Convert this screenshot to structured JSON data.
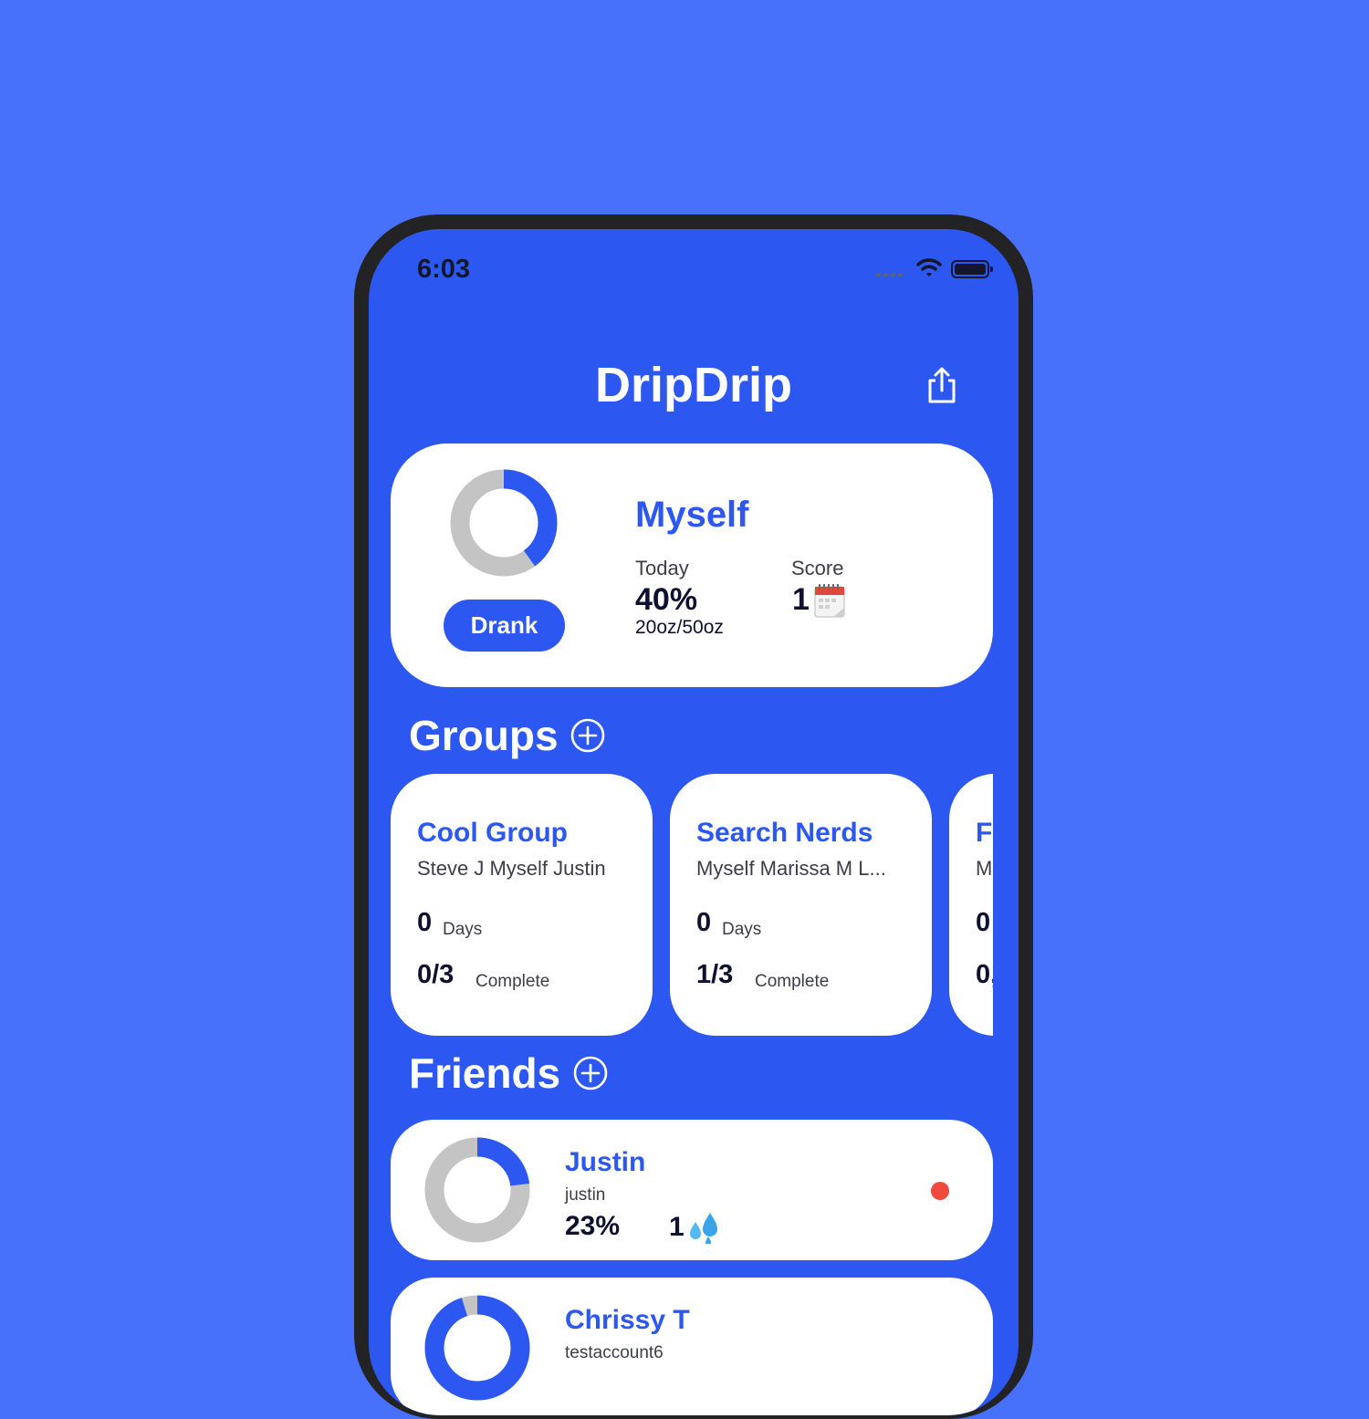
{
  "colors": {
    "background": "#4771fb",
    "screen": "#2c58f1",
    "accent": "#2c58f1",
    "ring_track": "#c4c4c4",
    "online_dot": "#f0493e"
  },
  "status_bar": {
    "time": "6:03",
    "icons": [
      "signal-dots-icon",
      "wifi-icon",
      "battery-icon"
    ]
  },
  "header": {
    "title": "DripDrip",
    "share_icon": "share-icon"
  },
  "myself": {
    "name": "Myself",
    "drank_button": "Drank",
    "today_label": "Today",
    "today_pct": "40%",
    "today_amount": "20oz/50oz",
    "score_label": "Score",
    "score_value": "1",
    "score_icon": "calendar-icon",
    "progress": 0.4
  },
  "groups": {
    "title": "Groups",
    "add_icon": "plus-circle-icon",
    "items": [
      {
        "name": "Cool Group",
        "members": "Steve J Myself Justin",
        "days": "0",
        "days_label": "Days",
        "complete": "0/3",
        "complete_label": "Complete"
      },
      {
        "name": "Search Nerds",
        "members": "Myself Marissa M L...",
        "days": "0",
        "days_label": "Days",
        "complete": "1/3",
        "complete_label": "Complete"
      },
      {
        "name": "F",
        "members": "M",
        "days": "0",
        "complete": "0,"
      }
    ]
  },
  "friends": {
    "title": "Friends",
    "add_icon": "plus-circle-icon",
    "items": [
      {
        "name": "Justin",
        "username": "justin",
        "pct": "23%",
        "streak": "1",
        "streak_icon": "droplets-icon",
        "progress": 0.23,
        "online": true
      },
      {
        "name": "Chrissy T",
        "username": "testaccount6",
        "progress": 0.95
      }
    ]
  }
}
